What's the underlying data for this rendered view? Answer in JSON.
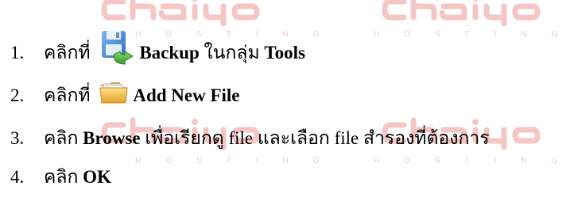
{
  "watermark": {
    "logo_text": "chaiyo",
    "subtext": "HOSTING",
    "color": "#f4c6c6"
  },
  "steps": [
    {
      "number": "1.",
      "prefix": "คลิกที่ ",
      "icon": "backup-icon",
      "label": "Backup",
      "middle": " ในกลุ่ม ",
      "group": "Tools"
    },
    {
      "number": "2.",
      "prefix": "คลิกที่ ",
      "icon": "add-file-icon",
      "label": "Add New File"
    },
    {
      "number": "3.",
      "prefix": "คลิก ",
      "label": "Browse",
      "suffix": " เพื่อเรียกดู file และเลือก file สำรองที่ต้องการ"
    },
    {
      "number": "4.",
      "prefix": "คลิก ",
      "label": "OK"
    }
  ]
}
